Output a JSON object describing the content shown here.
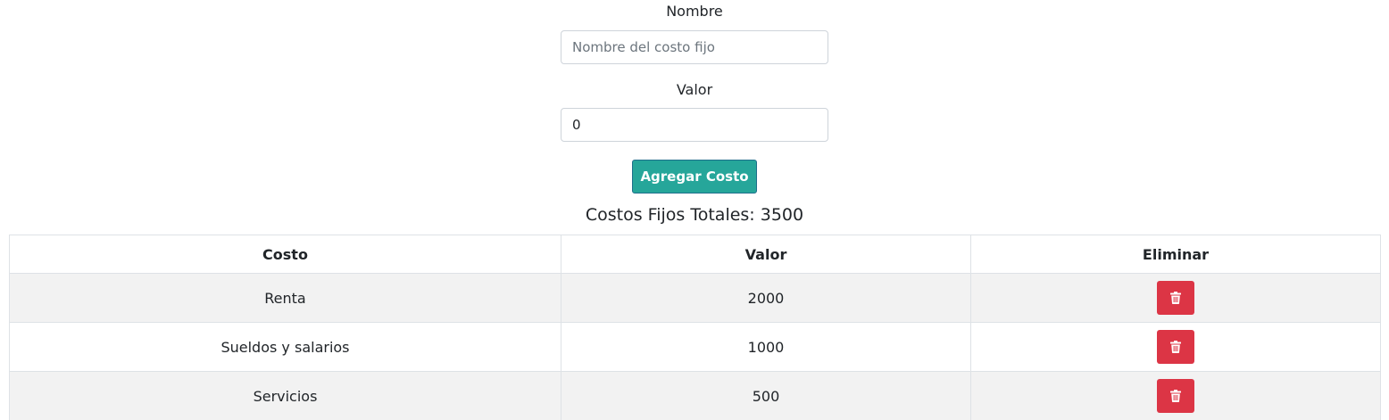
{
  "form": {
    "nombre_label": "Nombre",
    "nombre_placeholder": "Nombre del costo fijo",
    "nombre_value": "",
    "valor_label": "Valor",
    "valor_value": "0",
    "add_button_label": "Agregar Costo"
  },
  "summary": {
    "total_text": "Costos Fijos Totales: 3500"
  },
  "table": {
    "headers": [
      "Costo",
      "Valor",
      "Eliminar"
    ],
    "rows": [
      {
        "costo": "Renta",
        "valor": "2000",
        "action_icon": "trash-icon"
      },
      {
        "costo": "Sueldos y salarios",
        "valor": "1000",
        "action_icon": "trash-icon"
      },
      {
        "costo": "Servicios",
        "valor": "500",
        "action_icon": "trash-icon"
      }
    ]
  },
  "colors": {
    "add_button": "#26a69a",
    "delete_button": "#dc3545",
    "striped_row": "#f2f2f2"
  }
}
